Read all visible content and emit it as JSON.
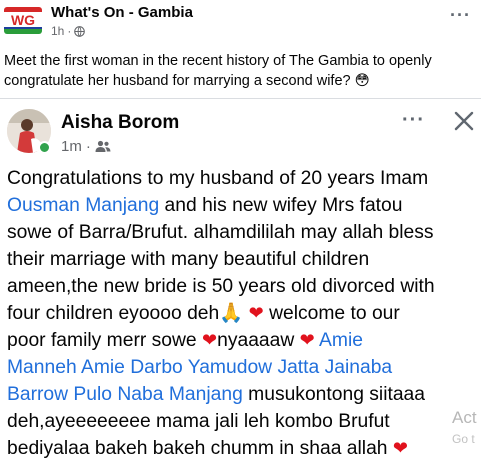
{
  "post": {
    "page_name": "What's On - Gambia",
    "time": "1h",
    "logo_text": "WG",
    "caption": "Meet the first woman in the recent history of The Gambia to openly congratulate her husband for marrying a second wife? 😳"
  },
  "embedded": {
    "author_name": "Aisha Borom",
    "time": "1m",
    "body_lines": [
      [
        {
          "t": "Congratulations to my husband of 20 years Imam"
        }
      ],
      [
        {
          "t": "Ousman Manjang",
          "m": true
        },
        {
          "t": " and his new wifey Mrs fatou"
        }
      ],
      [
        {
          "t": "sowe of Barra/Brufut. alhamdilila​h may allah bless"
        }
      ],
      [
        {
          "t": "their marriage with many beautiful children"
        }
      ],
      [
        {
          "t": "ameen,the new bride is 50 years old divorced with"
        }
      ],
      [
        {
          "t": "four children eyoooo deh"
        },
        {
          "t": "🙏",
          "e": true
        },
        {
          "t": " "
        },
        {
          "t": "❤",
          "h": true
        },
        {
          "t": "  welcome to our"
        }
      ],
      [
        {
          "t": "poor family merr sowe "
        },
        {
          "t": "❤",
          "h": true
        },
        {
          "t": "nyaaaaw "
        },
        {
          "t": "❤",
          "h": true
        },
        {
          "t": "  "
        },
        {
          "t": "Amie",
          "m": true
        }
      ],
      [
        {
          "t": "Manneh Amie Darbo Yamudow Jatta Jainaba",
          "m": true
        }
      ],
      [
        {
          "t": "Barrow Pulo Naba Manjang",
          "m": true
        },
        {
          "t": " musukontong siitaaa"
        }
      ],
      [
        {
          "t": "deh,ayeeeeeeee mama jali leh kombo Brufut"
        }
      ],
      [
        {
          "t": "bediyalaa bakeh bakeh chumm in shaa allah "
        },
        {
          "t": "❤",
          "h": true
        }
      ]
    ]
  },
  "watermark": {
    "line1": "Act",
    "line2": "Go t"
  },
  "colors": {
    "mention": "#216fdb",
    "heart": "#e1121d",
    "online": "#31a24c"
  }
}
